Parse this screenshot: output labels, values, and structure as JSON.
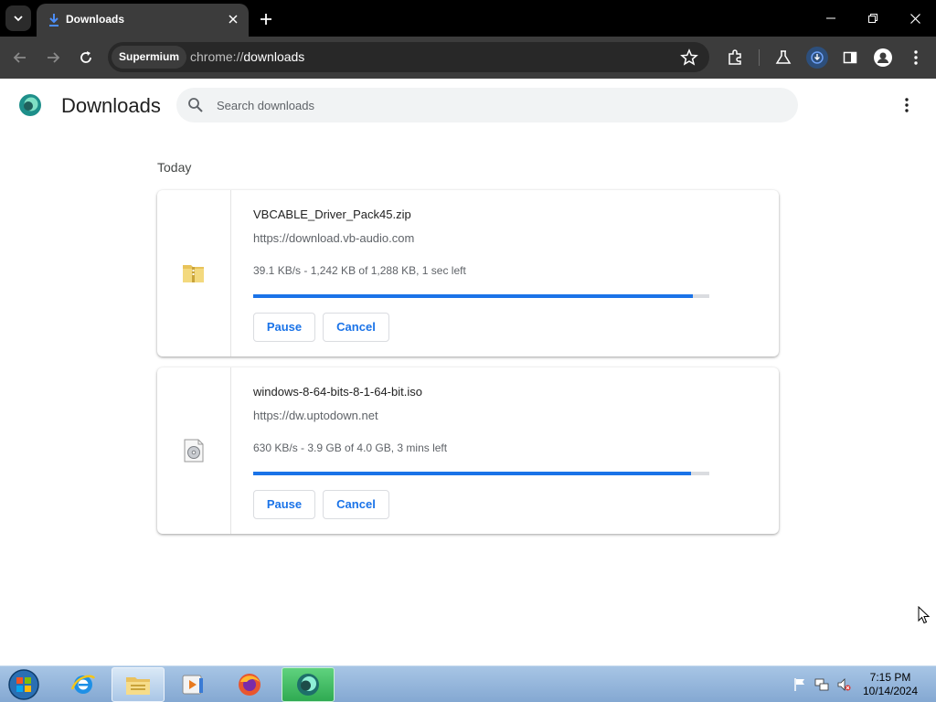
{
  "browser": {
    "tab_title": "Downloads",
    "omnibox_chip": "Supermium",
    "url_prefix": "chrome://",
    "url_host": "downloads"
  },
  "page": {
    "title": "Downloads",
    "search_placeholder": "Search downloads",
    "section_label": "Today"
  },
  "downloads": [
    {
      "file_name": "VBCABLE_Driver_Pack45.zip",
      "source_url": "https://download.vb-audio.com",
      "status": "39.1 KB/s - 1,242 KB of 1,288 KB, 1 sec left",
      "progress": 0.964,
      "pause_label": "Pause",
      "cancel_label": "Cancel",
      "icon": "zip-folder-icon"
    },
    {
      "file_name": "windows-8-64-bits-8-1-64-bit.iso",
      "source_url": "https://dw.uptodown.net",
      "status": "630 KB/s - 3.9 GB of 4.0 GB, 3 mins left",
      "progress": 0.96,
      "pause_label": "Pause",
      "cancel_label": "Cancel",
      "icon": "disc-image-icon"
    }
  ],
  "taskbar": {
    "time": "7:15 PM",
    "date": "10/14/2024",
    "apps": [
      "internet-explorer-icon",
      "file-explorer-icon",
      "media-player-icon",
      "firefox-icon",
      "supermium-icon"
    ]
  },
  "colors": {
    "accent": "#1a73e8",
    "browser_frame": "#000000",
    "toolbar": "#3c3c3c"
  }
}
